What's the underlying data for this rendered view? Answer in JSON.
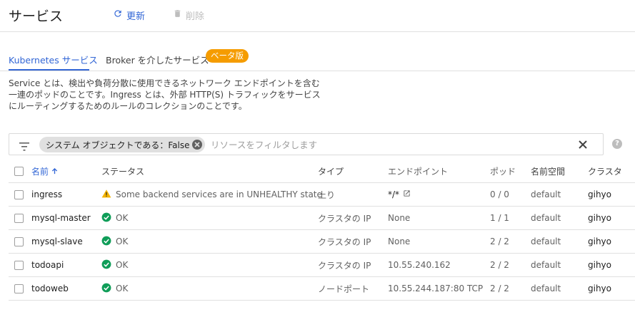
{
  "header": {
    "title": "サービス",
    "refresh_label": "更新",
    "delete_label": "削除"
  },
  "tabs": [
    {
      "label": "Kubernetes サービス",
      "active": true
    },
    {
      "label": "Broker を介したサービス",
      "badge": "ベータ版"
    }
  ],
  "description": "Service とは、検出や負荷分散に使用できるネットワーク エンドポイントを含む一連のポッドのことです。Ingress とは、外部 HTTP(S) トラフィックをサービスにルーティングするためのルールのコレクションのことです。",
  "filter": {
    "chip_label": "システム オブジェクトである：False",
    "placeholder": "リソースをフィルタします"
  },
  "table": {
    "columns": {
      "name": "名前",
      "status": "ステータス",
      "type": "タイプ",
      "endpoints": "エンドポイント",
      "pods": "ポッド",
      "namespace": "名前空間",
      "cluster": "クラスタ"
    },
    "rows": [
      {
        "name": "ingress",
        "status": "Some backend services are in UNHEALTHY state",
        "status_icon": "warning-icon",
        "type": "上り",
        "endpoint": "*/*",
        "pods": "0 / 0",
        "namespace": "default",
        "cluster": "gihyo"
      },
      {
        "name": "mysql-master",
        "status": "OK",
        "status_icon": "check-circle-icon",
        "type": "クラスタの IP",
        "endpoint": "None",
        "pods": "1 / 1",
        "namespace": "default",
        "cluster": "gihyo"
      },
      {
        "name": "mysql-slave",
        "status": "OK",
        "status_icon": "check-circle-icon",
        "type": "クラスタの IP",
        "endpoint": "None",
        "pods": "2 / 2",
        "namespace": "default",
        "cluster": "gihyo"
      },
      {
        "name": "todoapi",
        "status": "OK",
        "status_icon": "check-circle-icon",
        "type": "クラスタの IP",
        "endpoint": "10.55.240.162",
        "pods": "2 / 2",
        "namespace": "default",
        "cluster": "gihyo"
      },
      {
        "name": "todoweb",
        "status": "OK",
        "status_icon": "check-circle-icon",
        "type": "ノードポート",
        "endpoint": "10.55.244.187:80 TCP",
        "pods": "2 / 2",
        "namespace": "default",
        "cluster": "gihyo"
      }
    ]
  },
  "colors": {
    "accent": "#3367d6",
    "ok": "#0f9d58",
    "warning": "#f4b400",
    "badge": "#f59c00"
  }
}
